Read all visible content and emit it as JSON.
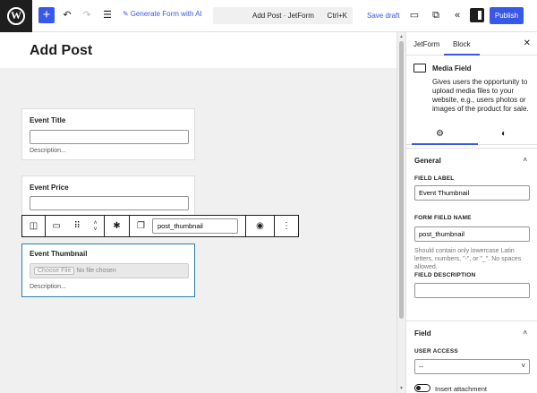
{
  "topbar": {
    "wp_logo": "W",
    "generate_label": "Generate Form with AI",
    "document_title": "Add Post · JetForm",
    "shortcut": "Ctrl+K",
    "save_draft": "Save draft",
    "publish": "Publish"
  },
  "canvas": {
    "page_title": "Add Post",
    "fields": [
      {
        "label": "Event Title",
        "description": "Description..."
      },
      {
        "label": "Event Price",
        "description": ""
      },
      {
        "label": "Event Thumbnail",
        "choose_file": "Choose File",
        "no_file": "No file chosen",
        "description": "Description..."
      }
    ],
    "toolbar": {
      "field_name": "post_thumbnail"
    }
  },
  "sidebar": {
    "tabs": [
      "JetForm",
      "Block"
    ],
    "active_tab": "Block",
    "block": {
      "name": "Media Field",
      "description": "Gives users the opportunity to upload media files to your website, e.g., users photos or images of the product for sale."
    },
    "general": {
      "title": "General",
      "field_label_label": "FIELD LABEL",
      "field_label_value": "Event Thumbnail",
      "form_field_name_label": "FORM FIELD NAME",
      "form_field_name_value": "post_thumbnail",
      "help": "Should contain only lowercase Latin letters, numbers, \"-\", or \"_\". No spaces allowed.",
      "field_description_label": "FIELD DESCRIPTION",
      "field_description_value": ""
    },
    "field": {
      "title": "Field",
      "user_access_label": "USER ACCESS",
      "user_access_value": "--",
      "insert_attachment": "Insert attachment"
    }
  },
  "colors": {
    "accent": "#3858e9",
    "selected_border": "#2b7fb8",
    "canvas_bg": "#f0f0f0"
  },
  "icons": [
    "plus-icon",
    "undo-icon",
    "redo-icon",
    "list-view-icon",
    "sparkle-icon",
    "desktop-icon",
    "external-link-icon",
    "chevrons-left-icon",
    "sidebar-icon",
    "gear-icon",
    "contrast-icon",
    "close-icon",
    "chevron-up-icon",
    "chevron-down-icon",
    "eye-icon",
    "more-vertical-icon",
    "asterisk-icon",
    "copy-icon",
    "drag-handle-icon"
  ]
}
